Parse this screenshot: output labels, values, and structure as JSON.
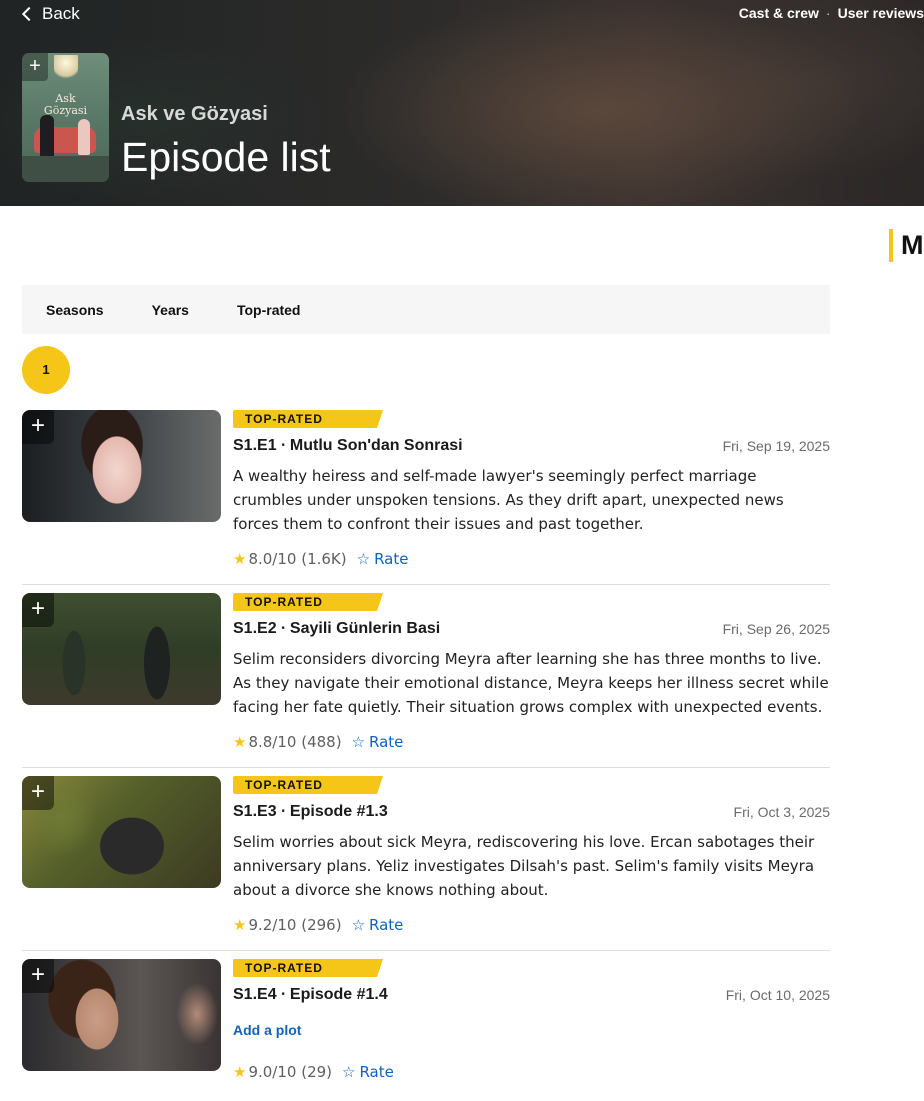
{
  "header": {
    "back_label": "Back",
    "links": [
      "Cast & crew",
      "User reviews"
    ],
    "link_separator": "·",
    "poster_title_line1": "Ask",
    "poster_title_line2": "Gözyasi",
    "show_title": "Ask ve Gözyasi",
    "page_title": "Episode list"
  },
  "side": {
    "heading": "More"
  },
  "tabs": [
    "Seasons",
    "Years",
    "Top-rated"
  ],
  "season_selected": "1",
  "accent_color": "#f5c518",
  "link_color": "#0e63be",
  "episodes": [
    {
      "badge": "TOP-RATED",
      "title": "S1.E1 ∙ Mutlu Son'dan Sonrasi",
      "date": "Fri, Sep 19, 2025",
      "plot": "A wealthy heiress and self-made lawyer's seemingly perfect marriage crumbles under unspoken tensions. As they drift apart, unexpected news forces them to confront their issues and past together.",
      "rating": "8.0/10 (1.6K)",
      "rate_label": "Rate"
    },
    {
      "badge": "TOP-RATED",
      "title": "S1.E2 ∙ Sayili Günlerin Basi",
      "date": "Fri, Sep 26, 2025",
      "plot": "Selim reconsiders divorcing Meyra after learning she has three months to live. As they navigate their emotional distance, Meyra keeps her illness secret while facing her fate quietly. Their situation grows complex with unexpected events.",
      "rating": "8.8/10 (488)",
      "rate_label": "Rate"
    },
    {
      "badge": "TOP-RATED",
      "title": "S1.E3 ∙ Episode #1.3",
      "date": "Fri, Oct 3, 2025",
      "plot": "Selim worries about sick Meyra, rediscovering his love. Ercan sabotages their anniversary plans. Yeliz investigates Dilsah's past. Selim's family visits Meyra about a divorce she knows nothing about.",
      "rating": "9.2/10 (296)",
      "rate_label": "Rate"
    },
    {
      "badge": "TOP-RATED",
      "title": "S1.E4 ∙ Episode #1.4",
      "date": "Fri, Oct 10, 2025",
      "add_plot_label": "Add a plot",
      "rating": "9.0/10 (29)",
      "rate_label": "Rate"
    }
  ]
}
